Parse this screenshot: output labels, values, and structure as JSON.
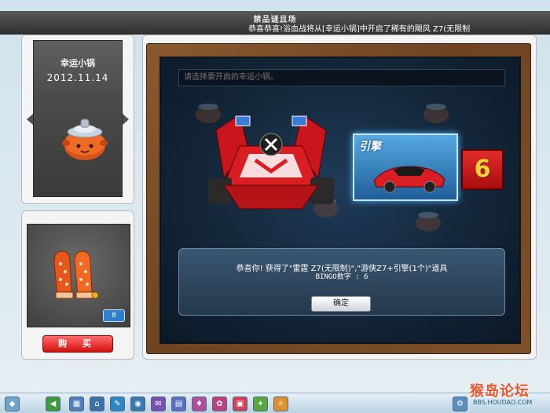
{
  "window": {
    "title": "禁品谜且场",
    "marquee": "恭喜恭喜!浴血战将从[幸运小锅]中开启了稀有的飓风 Z7(无限制"
  },
  "item_panel": {
    "name": "幸运小锅",
    "date": "2012.11.14"
  },
  "reward_panel": {
    "count": "8",
    "buy_label": "购 买"
  },
  "main": {
    "search_placeholder": "请选择要开启的幸运小锅。",
    "engine_label": "引擎",
    "bingo_number": "6"
  },
  "dialog": {
    "message": "恭喜你! 获得了\"雷霆 Z7(无限制)\",\"游侠Z7+引擎(1个)\"道具",
    "bingo_line": "BINGO数字 : 6",
    "ok_label": "确定"
  },
  "watermark": {
    "text": "猴岛论坛",
    "sub": "BBS.HOUDAO.COM"
  },
  "taskbar": {
    "icons": [
      "home-icon",
      "back-icon",
      "grid-icon",
      "house-icon",
      "tool-icon",
      "camera-icon",
      "mail-icon",
      "calendar-icon",
      "shop-icon",
      "chat-icon",
      "book-icon",
      "game-icon",
      "settings-icon",
      "photo-icon"
    ]
  },
  "colors": {
    "title_bar": "#2e2e2e",
    "buy_button": "#d31212",
    "wood_frame": "#6e4421",
    "bingo_box": "#c01a1a",
    "bingo_digit": "#ffd23a",
    "engine_card": "#2f7fc0"
  }
}
